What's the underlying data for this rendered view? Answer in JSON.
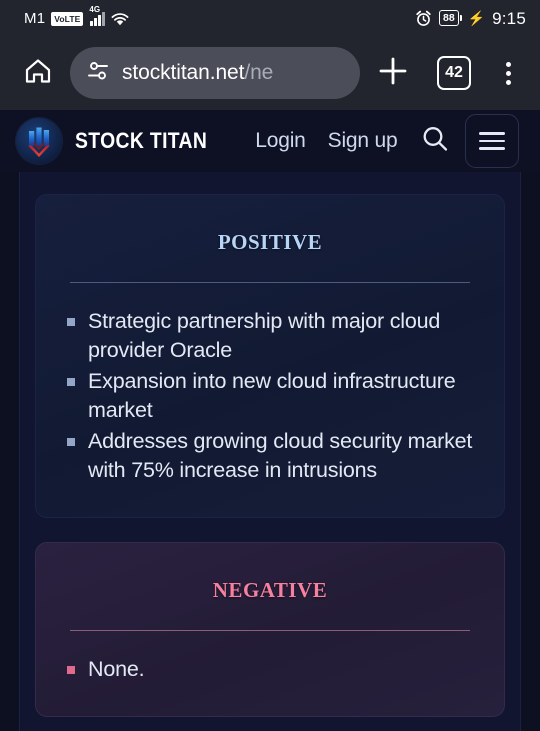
{
  "status_bar": {
    "carrier": "M1",
    "network_badge": "VoLTE",
    "network_type": "4G",
    "wifi_icon": "wifi-icon",
    "alarm_icon": "alarm-icon",
    "battery_level": "88",
    "charging_icon": "charging-bolt-icon",
    "time": "9:15"
  },
  "browser": {
    "home_icon": "home-icon",
    "site_settings_icon": "site-settings-icon",
    "url_main": "stocktitan.net",
    "url_path": "/ne",
    "new_tab_icon": "plus-icon",
    "tab_count": "42",
    "menu_icon": "overflow-menu-icon"
  },
  "site_header": {
    "logo_icon": "stock-titan-logo-icon",
    "brand": "STOCK TITAN",
    "login_label": "Login",
    "signup_label": "Sign up",
    "search_icon": "search-icon",
    "menu_icon": "hamburger-menu-icon"
  },
  "main": {
    "cards": [
      {
        "id": "positive",
        "title": "Positive",
        "accent": "#b7d6f7",
        "bullets": [
          "Strategic partnership with major cloud provider Oracle",
          "Expansion into new cloud infrastructure market",
          "Addresses growing cloud security market with 75% increase in intrusions"
        ]
      },
      {
        "id": "negative",
        "title": "Negative",
        "accent": "#f7809f",
        "bullets": [
          "None."
        ]
      }
    ]
  }
}
